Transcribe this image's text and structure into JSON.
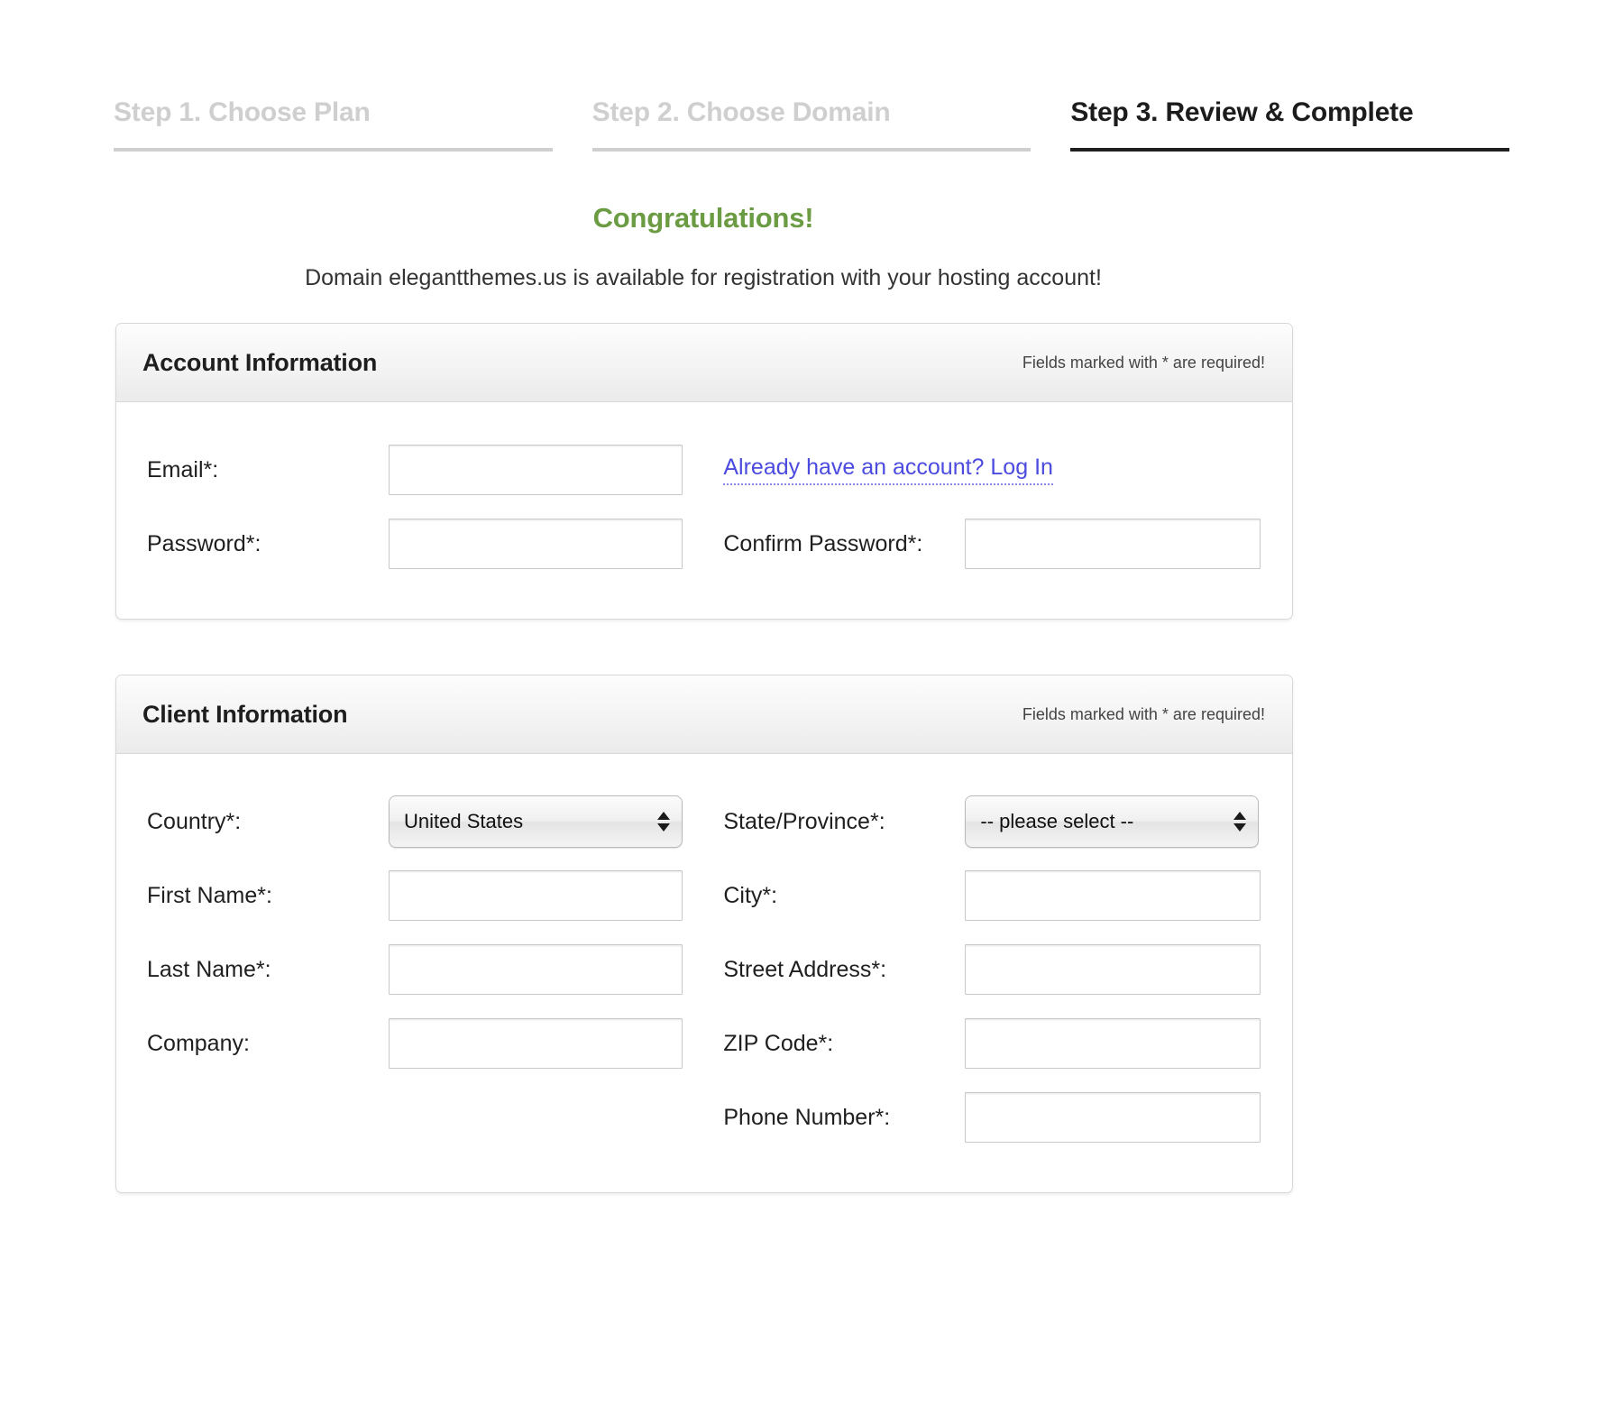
{
  "steps": [
    {
      "label": "Step 1. Choose Plan",
      "active": false
    },
    {
      "label": "Step 2. Choose Domain",
      "active": false
    },
    {
      "label": "Step 3. Review & Complete",
      "active": true
    }
  ],
  "headline": {
    "congratulations": "Congratulations!",
    "availability": "Domain elegantthemes.us is available for registration with your hosting account!"
  },
  "account_panel": {
    "title": "Account Information",
    "required_note": "Fields marked with * are required!",
    "email_label": "Email*:",
    "email_value": "",
    "login_link": "Already have an account? Log In",
    "password_label": "Password*:",
    "password_value": "",
    "confirm_password_label": "Confirm Password*:",
    "confirm_password_value": ""
  },
  "client_panel": {
    "title": "Client Information",
    "required_note": "Fields marked with * are required!",
    "country_label": "Country*:",
    "country_value": "United States",
    "state_label": "State/Province*:",
    "state_value": "-- please select --",
    "first_name_label": "First Name*:",
    "first_name_value": "",
    "city_label": "City*:",
    "city_value": "",
    "last_name_label": "Last Name*:",
    "last_name_value": "",
    "street_label": "Street Address*:",
    "street_value": "",
    "company_label": "Company:",
    "company_value": "",
    "zip_label": "ZIP Code*:",
    "zip_value": "",
    "phone_label": "Phone Number*:",
    "phone_value": ""
  },
  "colors": {
    "accent_green": "#6b9b42",
    "link_blue": "#4b4be0",
    "active_step": "#1c1c1c",
    "inactive_step": "#cfcfcf"
  },
  "icons": {
    "select_arrows": "chevron-up-down-icon"
  }
}
